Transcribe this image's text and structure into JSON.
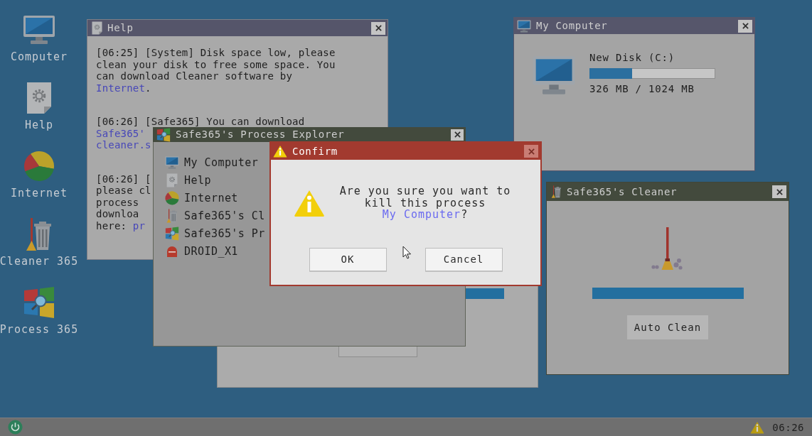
{
  "desktop_icons": [
    {
      "kind": "computer",
      "label": "Computer"
    },
    {
      "kind": "help",
      "label": "Help"
    },
    {
      "kind": "internet",
      "label": "Internet"
    },
    {
      "kind": "cleaner",
      "label": "Cleaner 365"
    },
    {
      "kind": "process",
      "label": "Process 365"
    }
  ],
  "help_window": {
    "title": "Help",
    "messages": [
      {
        "kind": "paragraph",
        "text": "[06:25] [System] Disk space low, please clean your disk to free some space. You can download Cleaner software by ",
        "link": "Internet",
        "after": "."
      },
      {
        "kind": "clipped",
        "lines": [
          {
            "text": "[06:26] [Safe365] You can download"
          },
          {
            "link": "Safe365'"
          },
          {
            "link": "cleaner.s"
          }
        ]
      },
      {
        "kind": "clipped",
        "lines": [
          {
            "text": "[06:26] ["
          },
          {
            "text": "please cl"
          },
          {
            "text": "process"
          },
          {
            "text": "downloa"
          },
          {
            "text": "here: ",
            "link": "pr"
          }
        ]
      }
    ]
  },
  "process_explorer": {
    "title": "Safe365's Process Explorer",
    "processes": [
      {
        "kind": "computer",
        "name": "My Computer",
        "selected": false
      },
      {
        "kind": "help",
        "name": "Help",
        "selected": false
      },
      {
        "kind": "internet",
        "name": "Internet",
        "selected": false
      },
      {
        "kind": "cleaner",
        "name": "Safe365's Cl",
        "selected": false
      },
      {
        "kind": "process",
        "name": "Safe365's Pr",
        "selected": false
      },
      {
        "kind": "droid",
        "name": "DROID_X1",
        "selected": false
      }
    ]
  },
  "confirm_dialog": {
    "title": "Confirm",
    "message": {
      "text": "Are you sure you want to kill this process ",
      "link": "My Computer",
      "after": "?"
    },
    "buttons": [
      "OK",
      "Cancel"
    ]
  },
  "my_computer": {
    "title": "My Computer",
    "disk": {
      "name": "New Disk (C:)",
      "level": 0.34,
      "usage": "326 MB / 1024 MB"
    }
  },
  "cleaner": {
    "title": "Safe365's Cleaner",
    "progress": {
      "level": 1
    },
    "button": "Auto Clean"
  },
  "taskbar": {
    "time": "06:26"
  }
}
